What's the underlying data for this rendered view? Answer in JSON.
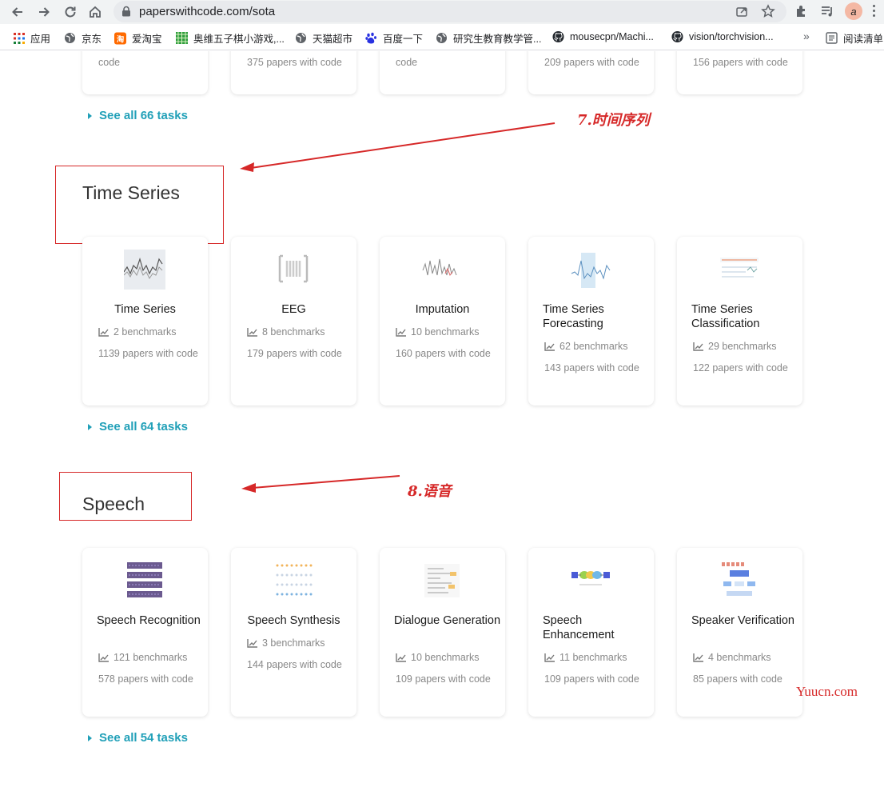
{
  "browser": {
    "url": "paperswithcode.com/sota",
    "bookmarks": [
      {
        "label": "应用"
      },
      {
        "label": "京东"
      },
      {
        "label": "爱淘宝"
      },
      {
        "label": "奥维五子棋小游戏,..."
      },
      {
        "label": "天猫超市"
      },
      {
        "label": "百度一下"
      },
      {
        "label": "研究生教育教学管..."
      },
      {
        "label": "mousecpn/Machi..."
      },
      {
        "label": "vision/torchvision..."
      },
      {
        "label": "阅读清单"
      }
    ],
    "more": "»"
  },
  "top_cards": [
    {
      "papers": "code"
    },
    {
      "papers": "375 papers with code"
    },
    {
      "papers": "code"
    },
    {
      "papers": "209 papers with code"
    },
    {
      "papers": "156 papers with code"
    }
  ],
  "sections": [
    {
      "see_all": "See all 66 tasks"
    },
    {
      "title": "Time Series",
      "cards": [
        {
          "title": "Time Series",
          "benchmarks": "2 benchmarks",
          "papers": "1139 papers with code"
        },
        {
          "title": "EEG",
          "benchmarks": "8 benchmarks",
          "papers": "179 papers with code"
        },
        {
          "title": "Imputation",
          "benchmarks": "10 benchmarks",
          "papers": "160 papers with code"
        },
        {
          "title": "Time Series Forecasting",
          "benchmarks": "62 benchmarks",
          "papers": "143 papers with code"
        },
        {
          "title": "Time Series Classification",
          "benchmarks": "29 benchmarks",
          "papers": "122 papers with code"
        }
      ],
      "see_all": "See all 64 tasks"
    },
    {
      "title": "Speech",
      "cards": [
        {
          "title": "Speech Recognition",
          "benchmarks": "121 benchmarks",
          "papers": "578 papers with code"
        },
        {
          "title": "Speech Synthesis",
          "benchmarks": "3 benchmarks",
          "papers": "144 papers with code"
        },
        {
          "title": "Dialogue Generation",
          "benchmarks": "10 benchmarks",
          "papers": "109 papers with code"
        },
        {
          "title": "Speech Enhancement",
          "benchmarks": "11 benchmarks",
          "papers": "109 papers with code"
        },
        {
          "title": "Speaker Verification",
          "benchmarks": "4 benchmarks",
          "papers": "85 papers with code"
        }
      ],
      "see_all": "See all 54 tasks"
    }
  ],
  "annotations": {
    "time_series": "7.时间序列",
    "speech": "8.语音"
  },
  "watermark": "Yuucn.com",
  "colors": {
    "accent": "#21a0b8",
    "annotation_red": "#d62828"
  }
}
